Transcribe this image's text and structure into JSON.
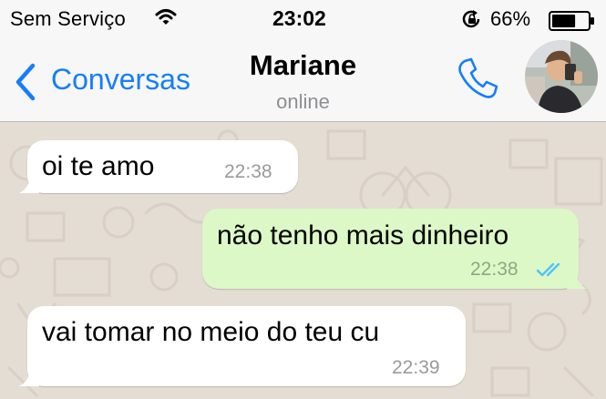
{
  "status_bar": {
    "carrier": "Sem Serviço",
    "time": "23:02",
    "battery": "66%",
    "battery_level": 0.66,
    "icons": [
      "wifi-icon",
      "rotation-lock-icon",
      "battery-icon"
    ]
  },
  "header": {
    "back_label": "Conversas",
    "contact_name": "Mariane",
    "contact_status": "online",
    "icons": [
      "chevron-left-icon",
      "phone-icon",
      "avatar"
    ]
  },
  "colors": {
    "accent": "#157efb",
    "outgoing_bubble": "#dcf8c6",
    "incoming_bubble": "#ffffff",
    "chat_background": "#e4ddd4",
    "read_ticks": "#4fc3f7"
  },
  "messages": [
    {
      "direction": "incoming",
      "text": "oi te amo",
      "time": "22:38"
    },
    {
      "direction": "outgoing",
      "text": "não tenho mais dinheiro",
      "time": "22:38",
      "status_icon": "double-check-icon"
    },
    {
      "direction": "incoming",
      "text": "vai tomar no meio do teu cu",
      "time": "22:39"
    }
  ]
}
